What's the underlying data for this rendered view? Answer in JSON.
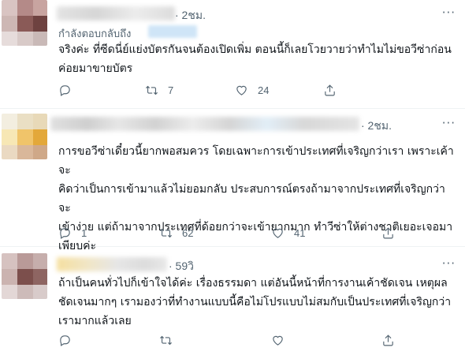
{
  "tweets": [
    {
      "time": "· 2ชม.",
      "more": "···",
      "replying_to": "กำลังตอบกลับถึง",
      "text_lines": [
        "จริงค่ะ ที่ซีดนี่ย์แย่งบัตรกันจนต้องเปิดเพิ่ม ตอนนี้ก็เลยโวยวายว่าทำไมไม่ขอวีซ่าก่อน",
        "ค่อยมาขายบัตร"
      ],
      "retweets": "7",
      "likes": "24"
    },
    {
      "time": "· 2ชม.",
      "more": "···",
      "text_lines": [
        "การขอวีซ่าเดี๋ยวนี้ยากพอสมควร โดยเฉพาะการเข้าประเทศที่เจริญกว่าเรา เพราะเค้าจะ",
        "คิดว่าเป็นการเข้ามาแล้วไม่ยอมกลับ ประสบการณ์ตรงถ้ามาจากประเทศที่เจริญกว่าจะ",
        "เข้าง่าย แต่ถ้ามาจากประเทศที่ด้อยกว่าจะเข้ายากมาก ทำวีซ่าให้ต่างชาติเยอะเจอมา",
        "เพียบค่ะ"
      ],
      "replies": "1",
      "retweets": "62",
      "likes": "41"
    },
    {
      "time": "· 59วิ",
      "more": "···",
      "text_lines": [
        "ถ้าเป็นคนทั่วไปก็เข้าใจได้ค่ะ เรื่องธรรมดา แต่อันนี้หน้าที่การงานเค้าชัดเจน เหตุผล",
        "ชัดเจนมากๆ เรามองว่าที่ทำงานแบบนี้คือไม่โปรแบบไม่สมกับเป็นประเทศที่เจริญกว่า",
        "เรามากแล้วเลย"
      ]
    }
  ],
  "colors": {
    "text": "#0f1419",
    "muted": "#536471",
    "divider": "#eff3f4"
  },
  "icons": [
    "reply-icon",
    "retweet-icon",
    "like-icon",
    "share-icon"
  ]
}
